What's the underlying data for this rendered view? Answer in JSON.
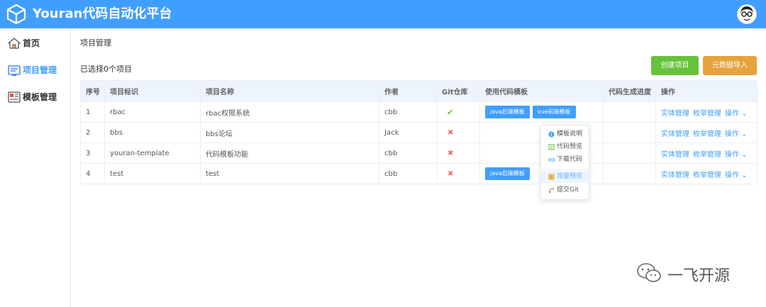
{
  "app": {
    "title": "Youran代码自动化平台"
  },
  "sidebar": {
    "items": [
      {
        "label": "首页",
        "icon": "home-icon"
      },
      {
        "label": "项目管理",
        "icon": "project-icon",
        "active": true
      },
      {
        "label": "模板管理",
        "icon": "template-icon"
      }
    ]
  },
  "page": {
    "breadcrumb": "项目管理",
    "selected_text": "已选择0个项目",
    "create_button": "创建项目",
    "import_button": "元数据导入"
  },
  "table": {
    "columns": [
      "序号",
      "项目标识",
      "项目名称",
      "作者",
      "Git仓库",
      "使用代码模板",
      "代码生成进度",
      "操作"
    ],
    "rows": [
      {
        "no": "1",
        "id": "rbac",
        "name": "rbac权限系统",
        "author": "cbb",
        "git": true,
        "templates": [
          "java后端模板",
          "vue前端模板"
        ]
      },
      {
        "no": "2",
        "id": "bbs",
        "name": "bbs论坛",
        "author": "Jack",
        "git": false,
        "templates": []
      },
      {
        "no": "3",
        "id": "youran-template",
        "name": "代码模板功能",
        "author": "cbb",
        "git": false,
        "templates": []
      },
      {
        "no": "4",
        "id": "test",
        "name": "test",
        "author": "cbb",
        "git": false,
        "templates": [
          "java后端模板"
        ]
      }
    ],
    "actions": {
      "entity": "实体管理",
      "enum": "枚举管理",
      "more": "操作"
    }
  },
  "dropdown": {
    "items": [
      {
        "label": "模板说明",
        "icon": "info-icon"
      },
      {
        "label": "代码预览",
        "icon": "preview-icon"
      },
      {
        "label": "下载代码",
        "icon": "link-icon"
      },
      {
        "label": "增量预览",
        "icon": "diff-icon",
        "highlighted": true
      },
      {
        "label": "提交Git",
        "icon": "git-icon"
      }
    ]
  },
  "watermark": {
    "text": "一飞开源"
  },
  "colors": {
    "primary": "#409eff",
    "success": "#67c23a",
    "warning": "#e6a23c",
    "danger": "#f56c6c"
  }
}
